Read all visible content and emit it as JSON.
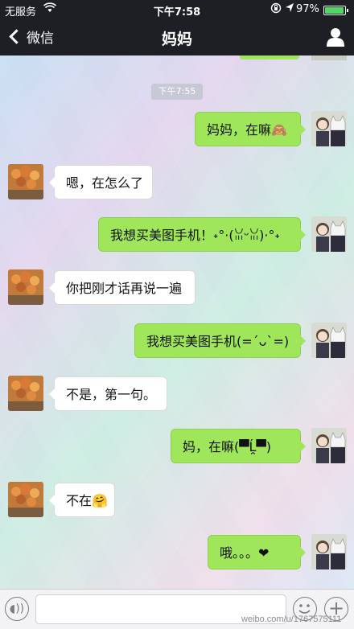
{
  "status": {
    "carrier": "无服务",
    "time": "下午7:58",
    "battery_pct": "97%",
    "battery_level": 0.97
  },
  "nav": {
    "back_label": "微信",
    "title": "妈妈"
  },
  "chat": {
    "timestamp": "下午7:55",
    "messages": [
      {
        "side": "right",
        "text": "妈妈，在嘛🙈"
      },
      {
        "side": "left",
        "text": "嗯，在怎么了"
      },
      {
        "side": "right",
        "text": "我想买美图手机！˖°·(ꈍᵕꈍ)·°˖"
      },
      {
        "side": "left",
        "text": "你把刚才话再说一遍"
      },
      {
        "side": "right",
        "text": "我想买美图手机(=´ᴗ`=)"
      },
      {
        "side": "left",
        "text": "不是，第一句。"
      },
      {
        "side": "right",
        "text": "妈，在嘛(▀̿Ĺ̯▀̿)"
      },
      {
        "side": "left",
        "text": "不在🤗"
      },
      {
        "side": "right",
        "text": "哦。。。❤"
      }
    ]
  },
  "input": {
    "placeholder": ""
  },
  "watermark": "weibo.com/u/1767575111",
  "icons": {
    "back": "chevron-left-icon",
    "profile": "person-icon",
    "voice": "voice-icon",
    "emoji": "emoji-icon",
    "plus": "plus-icon"
  },
  "colors": {
    "bar": "#1e1f24",
    "bubble_right": "#9fe65a",
    "bubble_left": "#ffffff"
  }
}
